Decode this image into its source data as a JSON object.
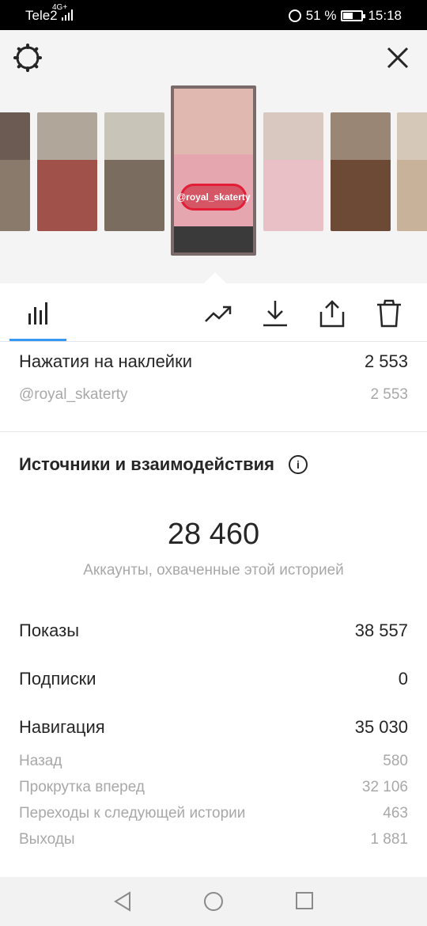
{
  "status_bar": {
    "carrier": "Tele2",
    "network": "4G+",
    "battery": "51 %",
    "battery_level": 0.51,
    "time": "15:18"
  },
  "header": {
    "settings_icon": "gear-icon",
    "close_icon": "close-icon"
  },
  "stories": {
    "selected_sticker": "@royal_skaterty",
    "count_visible": 7,
    "colors": [
      "#6c5b52",
      "#a0524a",
      "#7a6d60",
      "#e0b8b0",
      "#e9c0c6",
      "#6d4a35",
      "#c8b29a"
    ]
  },
  "toolbar": {
    "insights_icon": "bar-chart-icon",
    "promote_icon": "trending-up-icon",
    "download_icon": "download-icon",
    "share_icon": "share-icon",
    "delete_icon": "trash-icon",
    "accent": "#3897f0"
  },
  "sticker_taps": {
    "label": "Нажатия на наклейки",
    "value": "2 553",
    "items": [
      {
        "label": "@royal_skaterty",
        "value": "2 553"
      }
    ]
  },
  "sources": {
    "title": "Источники и взаимодействия",
    "info_icon": "info-icon",
    "reach_value": "28 460",
    "reach_label": "Аккаунты, охваченные этой историей",
    "rows": [
      {
        "label": "Показы",
        "value": "38 557"
      },
      {
        "label": "Подписки",
        "value": "0"
      },
      {
        "label": "Навигация",
        "value": "35 030"
      }
    ],
    "navigation": [
      {
        "label": "Назад",
        "value": "580"
      },
      {
        "label": "Прокрутка вперед",
        "value": "32 106"
      },
      {
        "label": "Переходы к следующей истории",
        "value": "463"
      },
      {
        "label": "Выходы",
        "value": "1 881"
      }
    ]
  },
  "system_nav": {
    "back_icon": "back-triangle-icon",
    "home_icon": "home-circle-icon",
    "recent_icon": "recent-square-icon"
  }
}
